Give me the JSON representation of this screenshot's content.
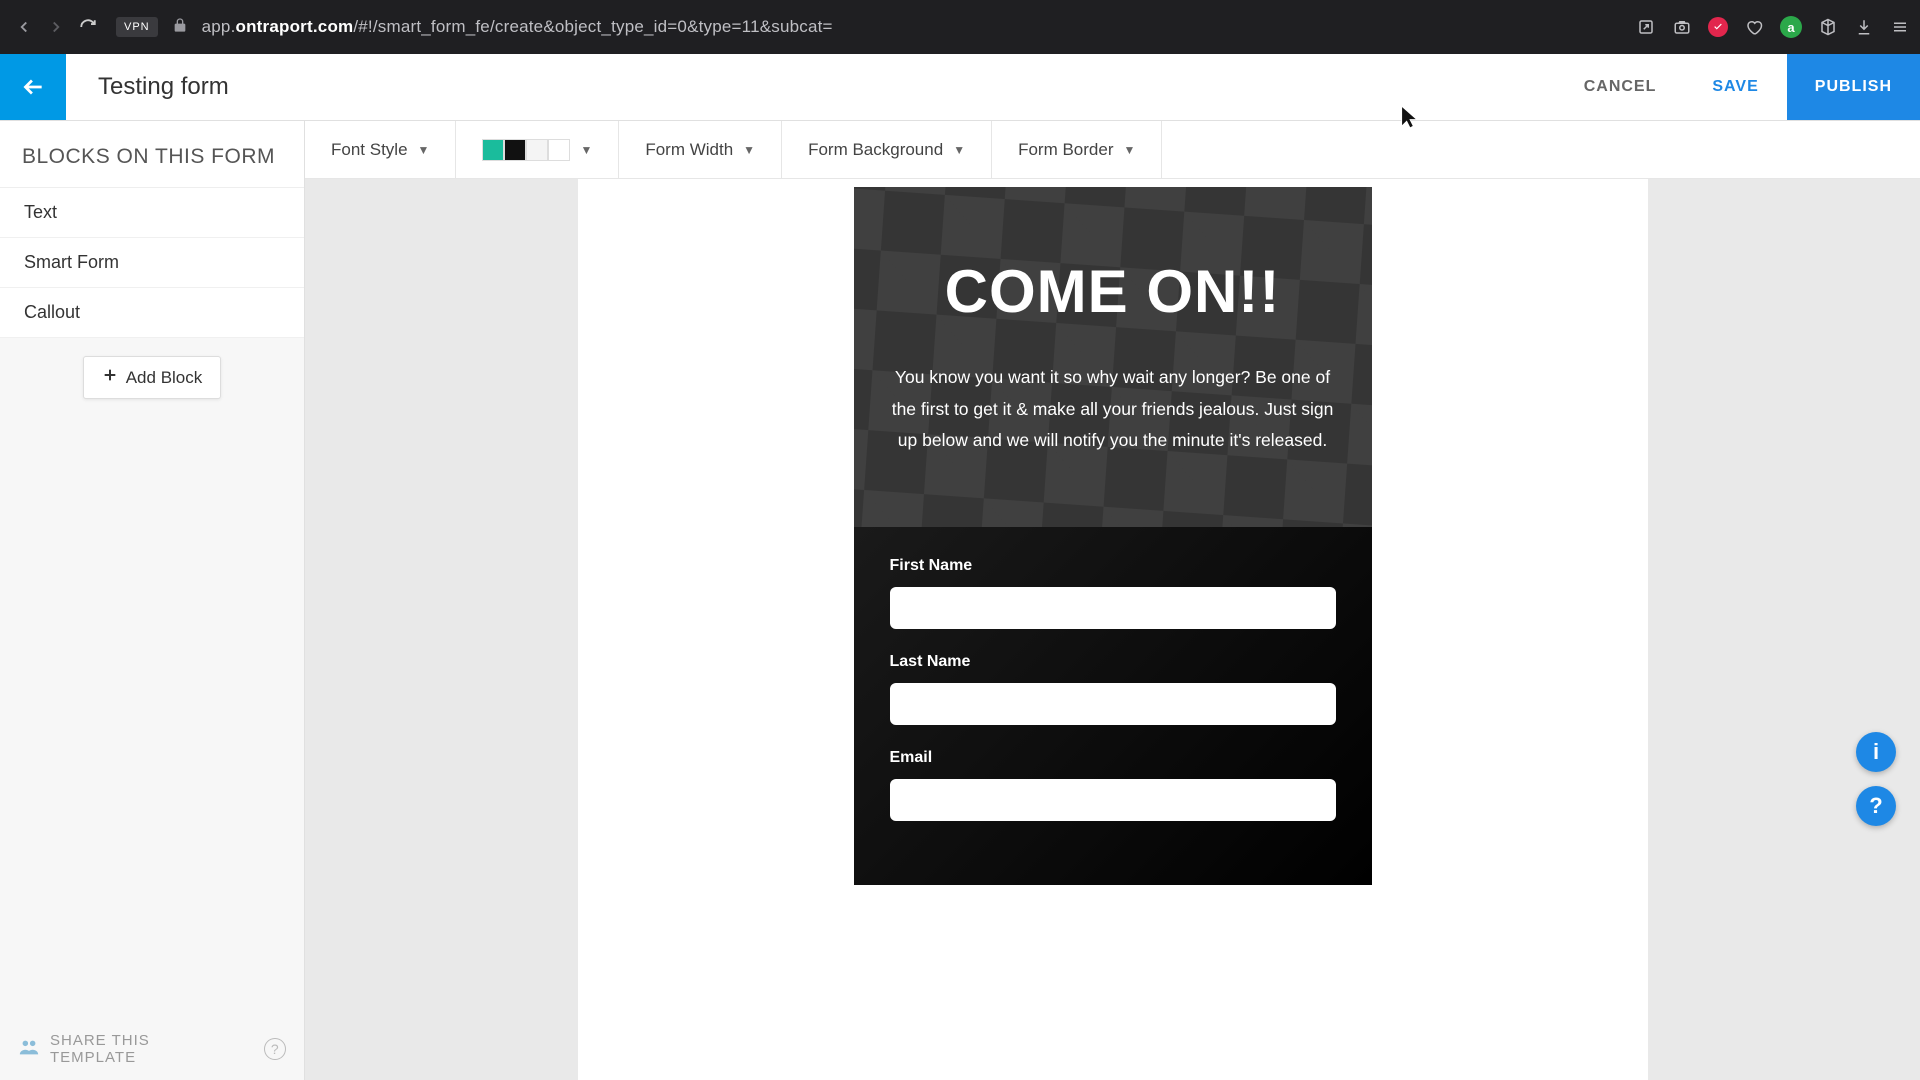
{
  "browser": {
    "url_prefix": "app.",
    "url_bold": "ontraport.com",
    "url_suffix": "/#!/smart_form_fe/create&object_type_id=0&type=11&subcat=",
    "vpn": "VPN",
    "avatar_letter": "a"
  },
  "header": {
    "title": "Testing form",
    "cancel": "CANCEL",
    "save": "SAVE",
    "publish": "PUBLISH"
  },
  "sidebar": {
    "heading": "BLOCKS ON THIS FORM",
    "blocks": [
      "Text",
      "Smart Form",
      "Callout"
    ],
    "add_block": "Add Block",
    "share": "SHARE THIS TEMPLATE",
    "help": "?"
  },
  "toolbar": {
    "font_style": "Font Style",
    "form_width": "Form Width",
    "form_background": "Form Background",
    "form_border": "Form Border",
    "colors": [
      "#1abc9c",
      "#111111",
      "#f4f4f4",
      "#ffffff"
    ]
  },
  "preview": {
    "heading": "COME ON!!",
    "body": "You know you want it so why wait any longer? Be one of the first to get it & make all your friends jealous.  Just sign up below and we will notify you the minute it's released.",
    "fields": [
      {
        "label": "First Name"
      },
      {
        "label": "Last Name"
      },
      {
        "label": "Email"
      }
    ]
  },
  "help": {
    "info": "i",
    "question": "?"
  }
}
